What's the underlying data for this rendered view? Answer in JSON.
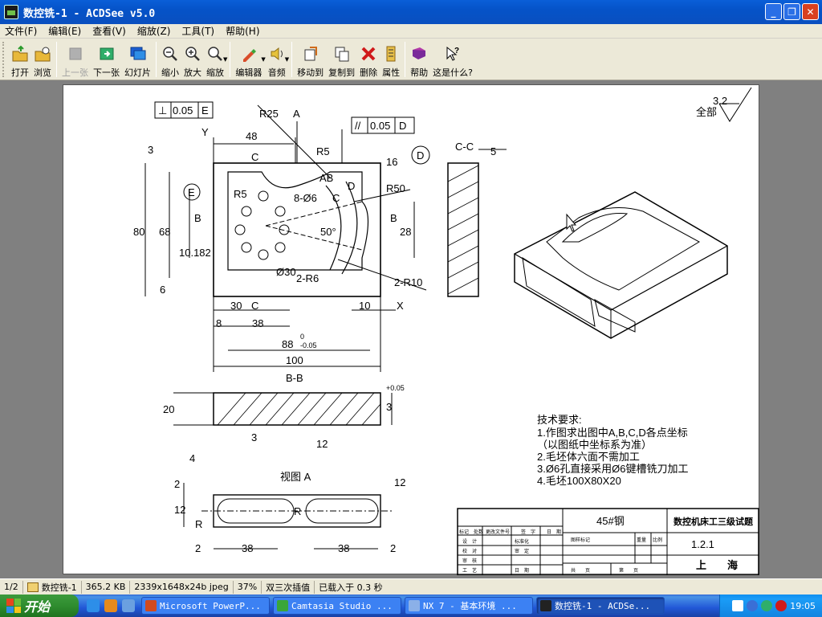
{
  "window": {
    "title": "数控铣-1 - ACDSee v5.0"
  },
  "menu": [
    "文件(F)",
    "编辑(E)",
    "查看(V)",
    "缩放(Z)",
    "工具(T)",
    "帮助(H)"
  ],
  "toolbar": {
    "open": "打开",
    "browse": "浏览",
    "prev": "上一张",
    "next": "下一张",
    "slideshow": "幻灯片",
    "zoom_out": "缩小",
    "zoom_in": "放大",
    "zoom": "缩放",
    "editor": "编辑器",
    "audio": "音频",
    "move": "移动到",
    "copy": "复制到",
    "delete": "删除",
    "props": "属性",
    "help": "帮助",
    "whatsthis": "这是什么?"
  },
  "drawing": {
    "roughness_value": "3.2",
    "roughness_all": "全部",
    "tol_perp": "⊥",
    "tol_perp_val": "0.05",
    "tol_perp_ref": "E",
    "tol_par": "//",
    "tol_par_val": "0.05",
    "tol_par_ref": "D",
    "labels": {
      "R25": "R25",
      "A": "A",
      "Y": "Y",
      "d48": "48",
      "d3": "3",
      "C": "C",
      "R5": "R5",
      "d16": "16",
      "D": "D",
      "CC": "C-C",
      "d5": "5",
      "E": "E",
      "B": "B",
      "AB": "AB",
      "d8phi6": "8-Ø6",
      "R5b": "R5",
      "R50": "R50",
      "d80": "80",
      "d68": "68",
      "d10182": "10.182",
      "d50": "50°",
      "d28": "28",
      "d6": "6",
      "phi30": "Ø30",
      "R6": "2-R6",
      "R10": "2-R10",
      "d30": "30",
      "d10": "10",
      "X": "X",
      "d8": "8",
      "d38": "38",
      "d88": "88",
      "tol0": "0",
      "tolm005": "-0.05",
      "d100": "100",
      "BB": "B-B",
      "d20": "20",
      "tolp005": "+0.05",
      "d3b": "3",
      "d12": "12",
      "d4": "4",
      "d12b": "12",
      "d12c": "12",
      "viewA": "视图 A",
      "d2": "2",
      "R": "R",
      "d38b": "38",
      "d2b": "2"
    },
    "tech_title": "技术要求:",
    "tech_items": [
      "1.作图求出图中A,B,C,D各点坐标",
      "（以图纸中坐标系为准）",
      "2.毛坯体六面不需加工",
      "3.Ø6孔直接采用Ø6键槽铣刀加工",
      "4.毛坯100X80X20"
    ],
    "title_block": {
      "material": "45#钢",
      "title": "数控机床工三级试题",
      "number": "1.2.1",
      "city": "上　　海",
      "r1": [
        "标记",
        "处数",
        "更改文件号",
        "签　字",
        "日　期"
      ],
      "r2": [
        "设　计",
        "标准化",
        "图样标记",
        "重量",
        "比例"
      ],
      "r3": [
        "校　对",
        "审　定"
      ],
      "r4": [
        "审　核"
      ],
      "r5": [
        "工　艺",
        "日　期",
        "共　　页",
        "第　　页"
      ]
    }
  },
  "status": {
    "index": "1/2",
    "name": "数控铣-1",
    "size": "365.2 KB",
    "dims": "2339x1648x24b jpeg",
    "zoom": "37%",
    "mode": "双三次插值",
    "load": "已载入于 0.3 秒"
  },
  "taskbar": {
    "start": "开始",
    "tasks": [
      "Microsoft PowerP...",
      "Camtasia Studio ...",
      "NX 7 - 基本环境 ...",
      "数控铣-1 - ACDSe..."
    ],
    "time": "19:05"
  },
  "colors": {
    "title": "#0553c8",
    "start": "#2f8d2f",
    "tray": "#1a9cf7"
  }
}
